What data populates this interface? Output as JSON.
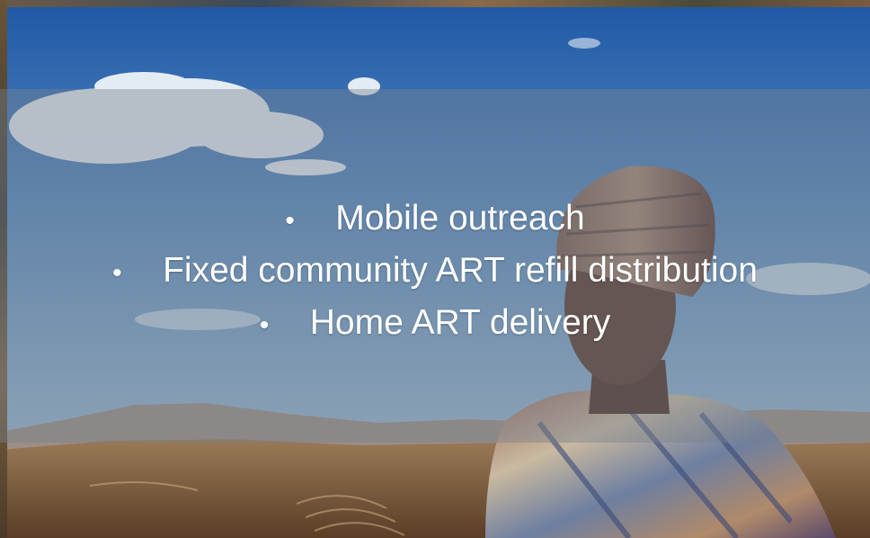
{
  "slide": {
    "bullets": [
      {
        "marker": "•",
        "text": "Mobile outreach"
      },
      {
        "marker": "•",
        "text": "Fixed community ART refill distribution"
      },
      {
        "marker": "•",
        "text": "Home ART delivery"
      }
    ]
  },
  "colors": {
    "sky_top": "#1f57a6",
    "sky_bottom": "#8fb2cf",
    "overlay": "#78808c",
    "text": "#ffffff",
    "ground": "#8a6a48"
  },
  "photo": {
    "subject": "person-in-wool-hat-and-blanket",
    "setting": "mountain-landscape-under-blue-sky"
  }
}
